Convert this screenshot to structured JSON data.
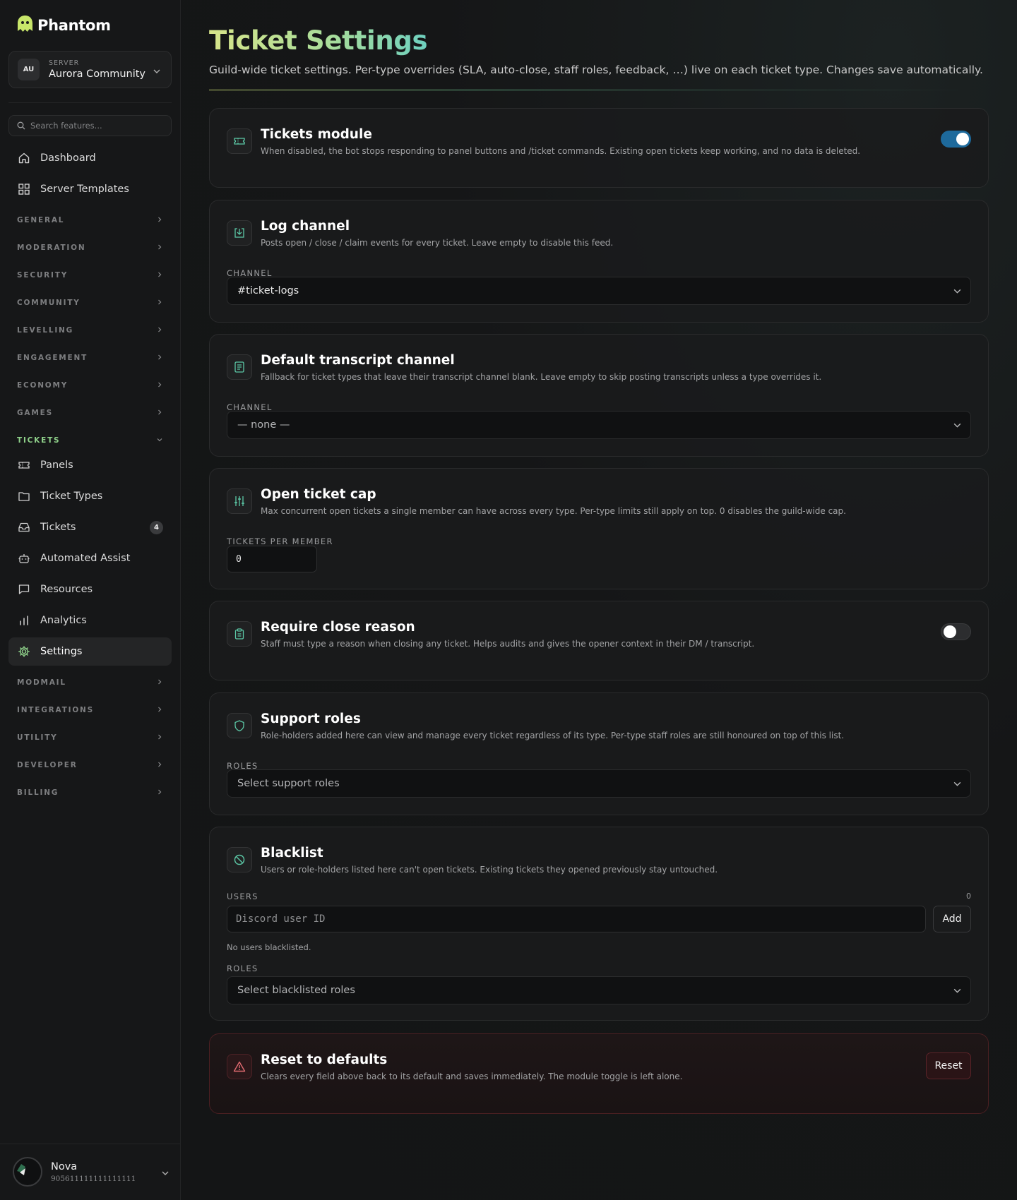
{
  "brand": {
    "name": "Phantom"
  },
  "server": {
    "initials": "AU",
    "caption": "SERVER",
    "name": "Aurora Community"
  },
  "search": {
    "placeholder": "Search features..."
  },
  "nav_top": [
    {
      "label": "Dashboard",
      "icon": "home-icon"
    },
    {
      "label": "Server Templates",
      "icon": "grid-icon"
    }
  ],
  "sections": [
    {
      "label": "GENERAL"
    },
    {
      "label": "MODERATION"
    },
    {
      "label": "SECURITY"
    },
    {
      "label": "COMMUNITY"
    },
    {
      "label": "LEVELLING"
    },
    {
      "label": "ENGAGEMENT"
    },
    {
      "label": "ECONOMY"
    },
    {
      "label": "GAMES"
    },
    {
      "label": "TICKETS"
    },
    {
      "label": "MODMAIL"
    },
    {
      "label": "INTEGRATIONS"
    },
    {
      "label": "UTILITY"
    },
    {
      "label": "DEVELOPER"
    },
    {
      "label": "BILLING"
    }
  ],
  "tickets_items": [
    {
      "label": "Panels",
      "icon": "ticket-icon"
    },
    {
      "label": "Ticket Types",
      "icon": "folder-icon"
    },
    {
      "label": "Tickets",
      "icon": "inbox-icon",
      "badge": "4"
    },
    {
      "label": "Automated Assist",
      "icon": "robot-icon"
    },
    {
      "label": "Resources",
      "icon": "message-square-icon"
    },
    {
      "label": "Analytics",
      "icon": "bar-chart-icon"
    },
    {
      "label": "Settings",
      "icon": "gear-icon",
      "active": true
    }
  ],
  "user": {
    "name": "Nova",
    "id": "905611111111111111"
  },
  "page": {
    "title": "Ticket Settings",
    "subtitle": "Guild-wide ticket settings. Per-type overrides (SLA, auto-close, staff roles, feedback, …) live on each ticket type. Changes save automatically."
  },
  "cards": {
    "module": {
      "title": "Tickets module",
      "desc": "When disabled, the bot stops responding to panel buttons and /ticket commands. Existing open tickets keep working, and no data is deleted.",
      "enabled": true
    },
    "log": {
      "title": "Log channel",
      "desc": "Posts open / close / claim events for every ticket. Leave empty to disable this feed.",
      "field_label": "CHANNEL",
      "value": "#ticket-logs"
    },
    "transcript": {
      "title": "Default transcript channel",
      "desc": "Fallback for ticket types that leave their transcript channel blank. Leave empty to skip posting transcripts unless a type overrides it.",
      "field_label": "CHANNEL",
      "value": "— none —"
    },
    "cap": {
      "title": "Open ticket cap",
      "desc": "Max concurrent open tickets a single member can have across every type. Per-type limits still apply on top. 0 disables the guild-wide cap.",
      "field_label": "TICKETS PER MEMBER",
      "value": "0"
    },
    "close_reason": {
      "title": "Require close reason",
      "desc": "Staff must type a reason when closing any ticket. Helps audits and gives the opener context in their DM / transcript.",
      "enabled": false
    },
    "support": {
      "title": "Support roles",
      "desc": "Role-holders added here can view and manage every ticket regardless of its type. Per-type staff roles are still honoured on top of this list.",
      "field_label": "ROLES",
      "placeholder": "Select support roles"
    },
    "blacklist": {
      "title": "Blacklist",
      "desc": "Users or role-holders listed here can't open tickets. Existing tickets they opened previously stay untouched.",
      "users_label": "USERS",
      "users_count": "0",
      "user_placeholder": "Discord user ID",
      "add_label": "Add",
      "empty_note": "No users blacklisted.",
      "roles_label": "ROLES",
      "roles_placeholder": "Select blacklisted roles"
    },
    "reset": {
      "title": "Reset to defaults",
      "desc": "Clears every field above back to its default and saves immediately. The module toggle is left alone.",
      "button_label": "Reset"
    }
  },
  "colors": {
    "accent_green": "#8fd18a",
    "toggle_on": "#1e6a9c",
    "danger": "#e06a70"
  }
}
